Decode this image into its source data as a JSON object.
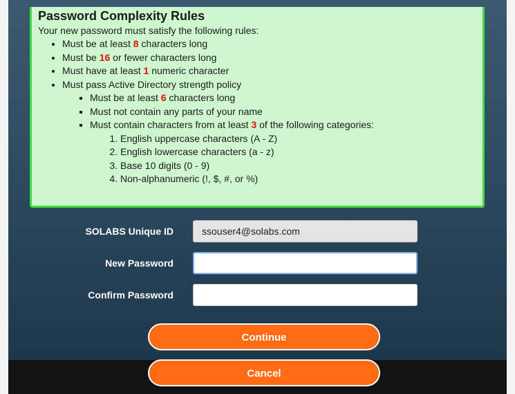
{
  "rules": {
    "title": "Password Complexity Rules",
    "intro": "Your new password must satisfy the following rules:",
    "r1_a": "Must be at least ",
    "r1_n": "8",
    "r1_b": " characters long",
    "r2_a": "Must be ",
    "r2_n": "16",
    "r2_b": " or fewer characters long",
    "r3_a": "Must have at least ",
    "r3_n": "1",
    "r3_b": " numeric character",
    "r4": "Must pass Active Directory strength policy",
    "ad1_a": "Must be at least ",
    "ad1_n": "6",
    "ad1_b": " characters long",
    "ad2": "Must not contain any parts of your name",
    "ad3_a": "Must contain characters from at least ",
    "ad3_n": "3",
    "ad3_b": " of the following categories:",
    "categories": [
      "English uppercase characters (A - Z)",
      "English lowercase characters (a - z)",
      "Base 10 digits (0 - 9)",
      "Non-alphanumeric (!, $, #, or %)"
    ]
  },
  "form": {
    "uid_label": "SOLABS Unique ID",
    "uid_value": "ssouser4@solabs.com",
    "new_label": "New Password",
    "new_value": "",
    "confirm_label": "Confirm Password",
    "confirm_value": ""
  },
  "buttons": {
    "continue": "Continue",
    "cancel": "Cancel"
  },
  "colors": {
    "panel_bg": "#cff7cf",
    "panel_border": "#3fdc3f",
    "highlight_number": "#e01010",
    "button": "#ff6a12",
    "background": "#2c4a60"
  }
}
